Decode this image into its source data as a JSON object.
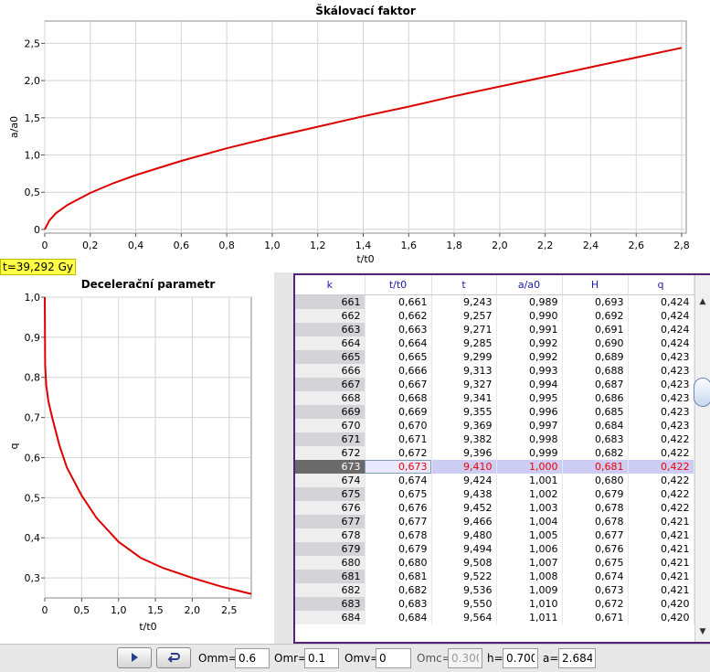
{
  "top_chart": {
    "title": "Škálovací faktor",
    "xlabel": "t/t0",
    "ylabel": "a/a0",
    "x_ticks": [
      "0",
      "0,2",
      "0,4",
      "0,6",
      "0,8",
      "1,0",
      "1,2",
      "1,4",
      "1,6",
      "1,8",
      "2,0",
      "2,2",
      "2,4",
      "2,6",
      "2,8"
    ],
    "y_ticks": [
      "0",
      "0,5",
      "1,0",
      "1,5",
      "2,0",
      "2,5"
    ]
  },
  "bottom_chart": {
    "title": "Decelerační parametr",
    "xlabel": "t/t0",
    "ylabel": "q",
    "x_ticks": [
      "0",
      "0,5",
      "1,0",
      "1,5",
      "2,0",
      "2,5"
    ],
    "y_ticks": [
      "0,3",
      "0,4",
      "0,5",
      "0,6",
      "0,7",
      "0,8",
      "0,9",
      "1,0"
    ]
  },
  "chart_data": [
    {
      "type": "line",
      "title": "Škálovací faktor",
      "xlabel": "t/t0",
      "ylabel": "a/a0",
      "xlim": [
        0,
        2.82
      ],
      "ylim": [
        -0.05,
        2.8
      ],
      "grid": true,
      "x": [
        0,
        0.02,
        0.05,
        0.1,
        0.2,
        0.3,
        0.4,
        0.6,
        0.8,
        1.0,
        1.2,
        1.4,
        1.6,
        1.8,
        2.0,
        2.2,
        2.4,
        2.6,
        2.8
      ],
      "series": [
        {
          "values": [
            0,
            0.12,
            0.22,
            0.33,
            0.49,
            0.62,
            0.73,
            0.92,
            1.09,
            1.24,
            1.38,
            1.52,
            1.65,
            1.79,
            1.92,
            2.05,
            2.18,
            2.31,
            2.44
          ],
          "color": "#dd0000"
        }
      ]
    },
    {
      "type": "line",
      "title": "Decelerační parametr",
      "xlabel": "t/t0",
      "ylabel": "q",
      "xlim": [
        0,
        2.8
      ],
      "ylim": [
        0.25,
        1.0
      ],
      "grid": true,
      "x": [
        0,
        0.005,
        0.02,
        0.05,
        0.1,
        0.2,
        0.3,
        0.5,
        0.7,
        1.0,
        1.3,
        1.6,
        2.0,
        2.4,
        2.8
      ],
      "series": [
        {
          "values": [
            1.0,
            0.83,
            0.78,
            0.74,
            0.7,
            0.63,
            0.575,
            0.505,
            0.45,
            0.39,
            0.35,
            0.325,
            0.3,
            0.278,
            0.26
          ],
          "color": "#dd0000"
        }
      ]
    }
  ],
  "time_badge": "t=39,292 Gy",
  "table": {
    "headers": [
      "k",
      "t/t0",
      "t",
      "a/a0",
      "H",
      "q"
    ],
    "rows": [
      [
        "661",
        "0,661",
        "9,243",
        "0,989",
        "0,693",
        "0,424"
      ],
      [
        "662",
        "0,662",
        "9,257",
        "0,990",
        "0,692",
        "0,424"
      ],
      [
        "663",
        "0,663",
        "9,271",
        "0,991",
        "0,691",
        "0,424"
      ],
      [
        "664",
        "0,664",
        "9,285",
        "0,992",
        "0,690",
        "0,424"
      ],
      [
        "665",
        "0,665",
        "9,299",
        "0,992",
        "0,689",
        "0,423"
      ],
      [
        "666",
        "0,666",
        "9,313",
        "0,993",
        "0,688",
        "0,423"
      ],
      [
        "667",
        "0,667",
        "9,327",
        "0,994",
        "0,687",
        "0,423"
      ],
      [
        "668",
        "0,668",
        "9,341",
        "0,995",
        "0,686",
        "0,423"
      ],
      [
        "669",
        "0,669",
        "9,355",
        "0,996",
        "0,685",
        "0,423"
      ],
      [
        "670",
        "0,670",
        "9,369",
        "0,997",
        "0,684",
        "0,423"
      ],
      [
        "671",
        "0,671",
        "9,382",
        "0,998",
        "0,683",
        "0,422"
      ],
      [
        "672",
        "0,672",
        "9,396",
        "0,999",
        "0,682",
        "0,422"
      ],
      [
        "673",
        "0,673",
        "9,410",
        "1,000",
        "0,681",
        "0,422"
      ],
      [
        "674",
        "0,674",
        "9,424",
        "1,001",
        "0,680",
        "0,422"
      ],
      [
        "675",
        "0,675",
        "9,438",
        "1,002",
        "0,679",
        "0,422"
      ],
      [
        "676",
        "0,676",
        "9,452",
        "1,003",
        "0,678",
        "0,422"
      ],
      [
        "677",
        "0,677",
        "9,466",
        "1,004",
        "0,678",
        "0,421"
      ],
      [
        "678",
        "0,678",
        "9,480",
        "1,005",
        "0,677",
        "0,421"
      ],
      [
        "679",
        "0,679",
        "9,494",
        "1,006",
        "0,676",
        "0,421"
      ],
      [
        "680",
        "0,680",
        "9,508",
        "1,007",
        "0,675",
        "0,421"
      ],
      [
        "681",
        "0,681",
        "9,522",
        "1,008",
        "0,674",
        "0,421"
      ],
      [
        "682",
        "0,682",
        "9,536",
        "1,009",
        "0,673",
        "0,421"
      ],
      [
        "683",
        "0,683",
        "9,550",
        "1,010",
        "0,672",
        "0,420"
      ],
      [
        "684",
        "0,684",
        "9,564",
        "1,011",
        "0,671",
        "0,420"
      ]
    ],
    "selected_k": "673"
  },
  "controls": {
    "play_icon": "play-icon",
    "reset_icon": "reset-icon",
    "omm_label": "Omm=",
    "omm_value": "0.6",
    "omr_label": "Omr=",
    "omr_value": "0.1",
    "omv_label": "Omv=",
    "omv_value": "0",
    "omc_label": "Omc=",
    "omc_value": "0.300",
    "h_label": "h=",
    "h_value": "0.700",
    "a_label": "a=",
    "a_value": "2.684"
  }
}
